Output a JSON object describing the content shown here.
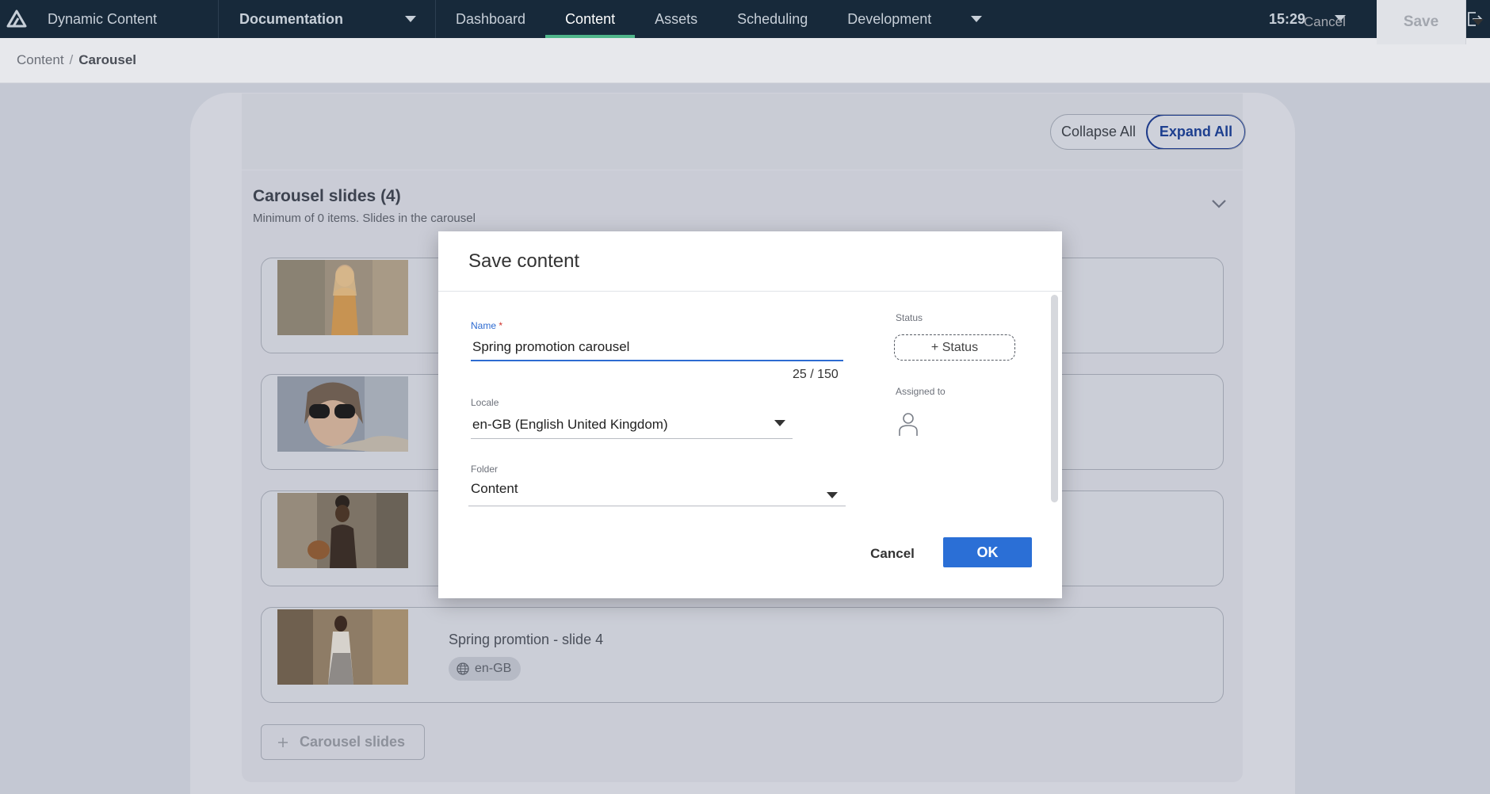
{
  "app": {
    "title": "Dynamic Content"
  },
  "hub": {
    "label": "Documentation"
  },
  "nav": {
    "tabs": [
      {
        "label": "Dashboard",
        "active": false
      },
      {
        "label": "Content",
        "active": true
      },
      {
        "label": "Assets",
        "active": false
      },
      {
        "label": "Scheduling",
        "active": false
      },
      {
        "label": "Development",
        "active": false
      }
    ],
    "clock": "15:29"
  },
  "breadcrumb": {
    "root": "Content",
    "separator": "/",
    "current": "Carousel"
  },
  "toolbar": {
    "cancel_label": "Cancel",
    "save_label": "Save"
  },
  "view_toggle": {
    "collapse_label": "Collapse All",
    "expand_label": "Expand All"
  },
  "slides_section": {
    "title": "Carousel slides (4)",
    "subtitle": "Minimum of 0 items. Slides in the carousel",
    "add_label": "Carousel slides",
    "slides": [
      {
        "title": "",
        "locale": ""
      },
      {
        "title": "",
        "locale": ""
      },
      {
        "title": "",
        "locale": ""
      },
      {
        "title": "Spring promtion - slide 4",
        "locale": "en-GB"
      }
    ]
  },
  "modal": {
    "title": "Save content",
    "name_label": "Name",
    "name_required_mark": "*",
    "name_value": "Spring promotion carousel",
    "name_counter": "25 / 150",
    "locale_label": "Locale",
    "locale_value": "en-GB (English United Kingdom)",
    "folder_label": "Folder",
    "folder_value": "Content",
    "status_label": "Status",
    "status_button": "+ Status",
    "assigned_label": "Assigned to",
    "cancel_label": "Cancel",
    "ok_label": "OK"
  },
  "colors": {
    "topbar": "#17293a",
    "active_tab_indicator": "#4fb58a",
    "primary": "#2b6fd6",
    "focus": "#2d6bd1",
    "expand_border": "#1e3b8a"
  }
}
